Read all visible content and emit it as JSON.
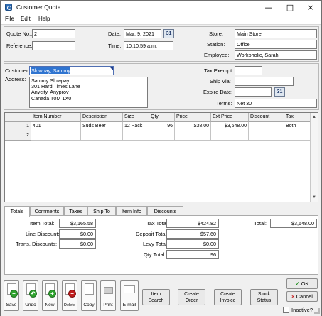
{
  "window": {
    "title": "Customer Quote",
    "menu": [
      "File",
      "Edit",
      "Help"
    ]
  },
  "header": {
    "quote_no_label": "Quote No.:",
    "quote_no": "2",
    "reference_label": "Reference:",
    "reference": "",
    "date_label": "Date:",
    "date": "Mar. 9, 2021",
    "time_label": "Time:",
    "time": "10:10:59 a.m.",
    "store_label": "Store:",
    "store": "Main Store",
    "station_label": "Station:",
    "station": "Office",
    "employee_label": "Employee:",
    "employee": "Workoholic, Sarah"
  },
  "customer": {
    "customer_label": "Customer:",
    "customer": "Slowpay, Sammy",
    "address_label": "Address:",
    "address": "Sammy Slowpay\n301 Hard Times Lane\nAnycity, Anyprov\nCanada  T0M 1X0",
    "tax_exempt_label": "Tax Exempt:",
    "tax_exempt": "",
    "ship_via_label": "Ship Via:",
    "ship_via": "",
    "expire_date_label": "Expire Date:",
    "expire_date": "",
    "terms_label": "Terms:",
    "terms": "Net 30"
  },
  "grid": {
    "columns": [
      "",
      "Item Number",
      "Description",
      "Size",
      "Qty",
      "Price",
      "Ext Price",
      "Discount",
      "Tax"
    ],
    "rows": [
      [
        "1",
        "401",
        "Suds Beer",
        "12 Pack",
        "96",
        "$38.00",
        "$3,648.00",
        "",
        "Both"
      ],
      [
        "2",
        "",
        "",
        "",
        "",
        "",
        "",
        "",
        ""
      ]
    ]
  },
  "tabs": [
    "Totals",
    "Comments",
    "Taxes",
    "Ship To",
    "Item Info",
    "Discounts"
  ],
  "totals": {
    "item_total_label": "Item Total:",
    "item_total": "$3,165.58",
    "line_discounts_label": "Line Discounts:",
    "line_discounts": "$0.00",
    "trans_discounts_label": "Trans. Discounts:",
    "trans_discounts": "$0.00",
    "tax_total_label": "Tax Total:",
    "tax_total": "$424.82",
    "deposit_total_label": "Deposit Total:",
    "deposit_total": "$57.60",
    "levy_total_label": "Levy Total:",
    "levy_total": "$0.00",
    "qty_total_label": "Qty Total:",
    "qty_total": "96",
    "total_label": "Total:",
    "total": "$3,648.00"
  },
  "toolbar": {
    "save": "Save",
    "undo": "Undo",
    "new": "New",
    "delete": "Delete",
    "copy": "Copy",
    "print": "Print",
    "email": "E-mail",
    "item_search": "Item\nSearch",
    "create_order": "Create\nOrder",
    "create_invoice": "Create\nInvoice",
    "stock_status": "Stock\nStatus",
    "ok": "OK",
    "cancel": "Cancel",
    "inactive": "Inactive?"
  },
  "icons": {
    "calendar": "calendar-icon",
    "dropdown": "chevron-down-icon"
  }
}
